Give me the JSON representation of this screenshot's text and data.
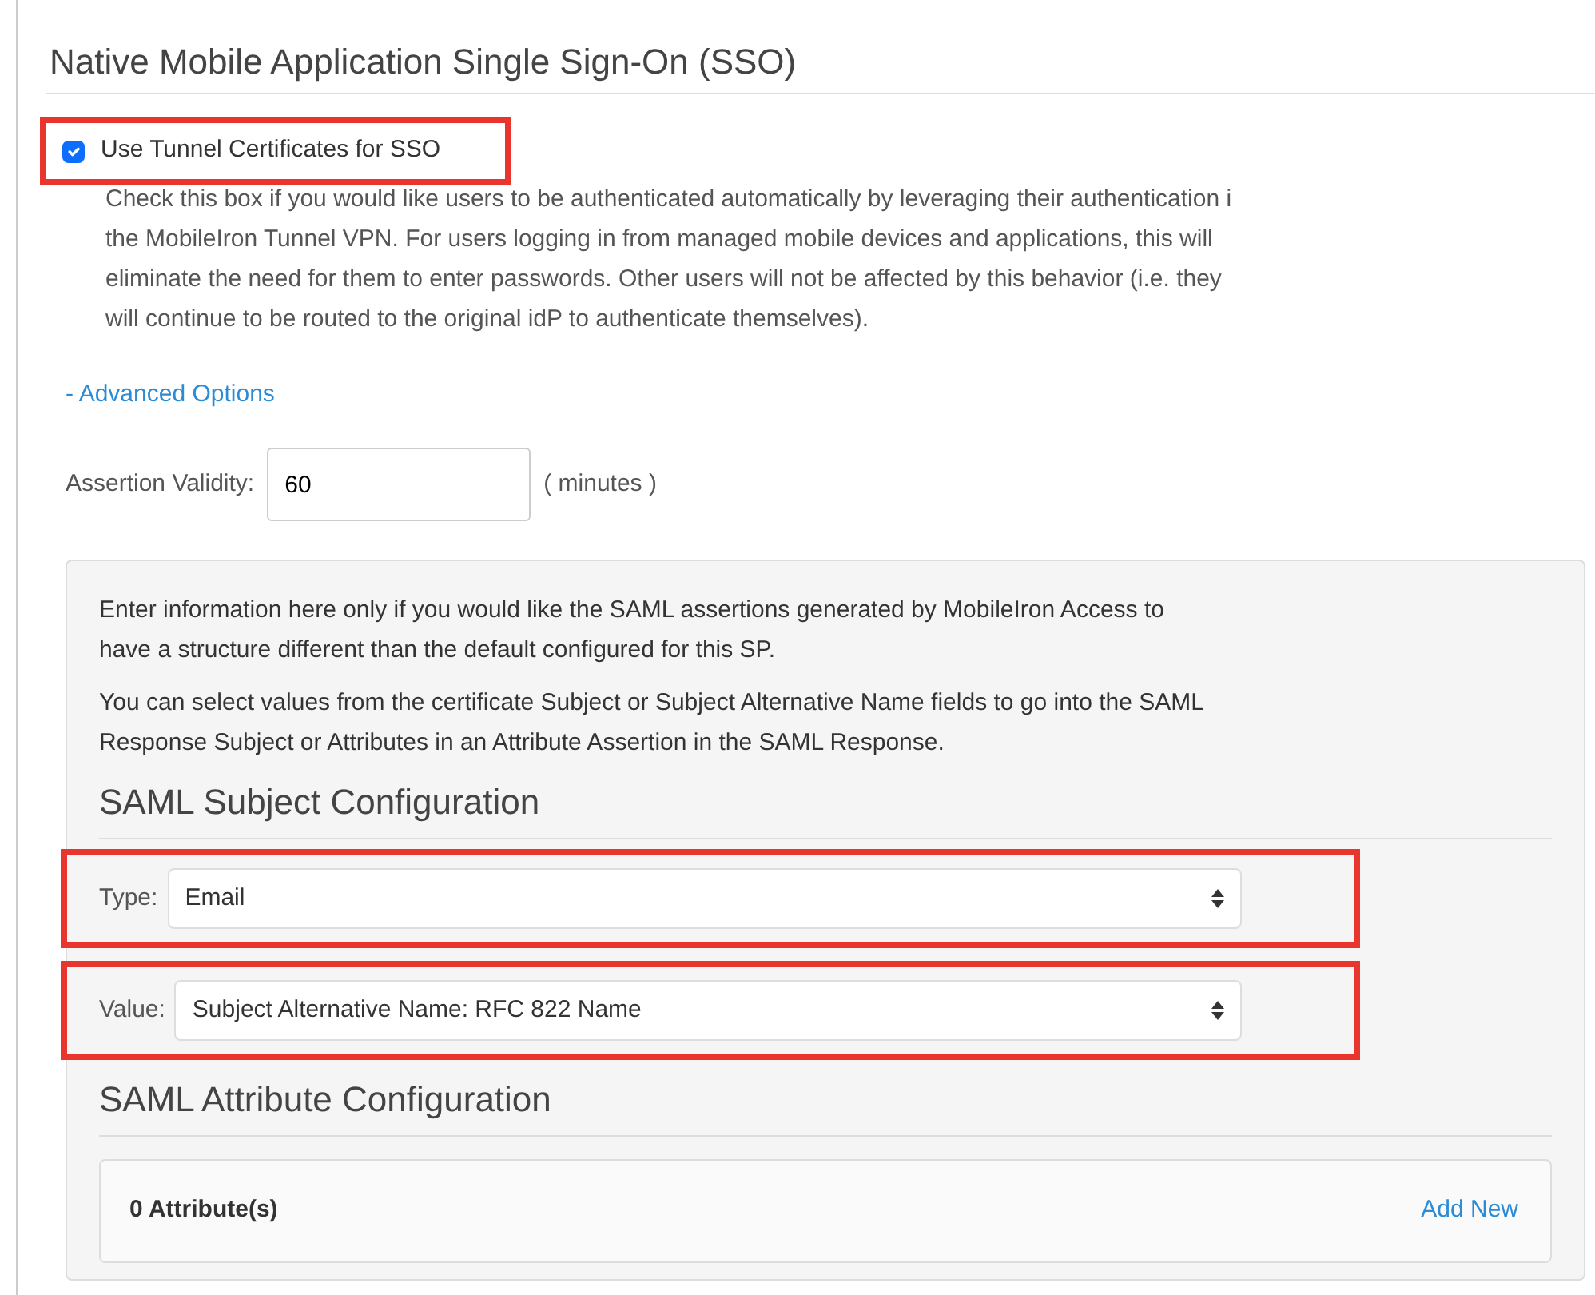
{
  "section_title": "Native Mobile Application Single Sign-On (SSO)",
  "sso_checkbox": {
    "label": "Use Tunnel Certificates for SSO",
    "checked": true,
    "highlighted": true
  },
  "sso_help_lines": [
    "Check this box if you would like users to be authenticated automatically by leveraging their authentication i",
    "the MobileIron Tunnel VPN. For users logging in from managed mobile devices and applications, this will",
    "eliminate the need for them to enter passwords. Other users will not be affected by this behavior (i.e. they",
    "will continue to be routed to the original idP to authenticate themselves)."
  ],
  "advanced_link": "- Advanced Options",
  "assertion_validity": {
    "label": "Assertion Validity:",
    "value": "60",
    "unit": "( minutes )"
  },
  "panel": {
    "intro_lines": [
      "Enter information here only if you would like the SAML assertions generated by MobileIron Access to",
      "have a structure different than the default configured for this SP."
    ],
    "info_lines": [
      "You can select values from the certificate Subject or Subject Alternative Name fields to go into the SAML",
      "Response Subject or Attributes in an Attribute Assertion in the SAML Response."
    ],
    "subject_heading": "SAML Subject Configuration",
    "subject_fields": [
      {
        "label": "Type:",
        "value": "Email",
        "highlighted": true
      },
      {
        "label": "Value:",
        "value": "Subject Alternative Name: RFC 822 Name",
        "highlighted": true
      }
    ],
    "attribute_heading": "SAML Attribute Configuration",
    "attributes": {
      "count": "0 Attribute(s)",
      "add_link": "Add New"
    }
  }
}
